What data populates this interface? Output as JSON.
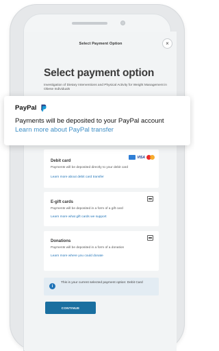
{
  "header": {
    "title": "Select Payment Option",
    "close_label": "×"
  },
  "main": {
    "title": "Select payment option",
    "subtitle": "Investigation of Dietary Interventions and Physical Activity for Weight Management in Obese Individuals"
  },
  "popup": {
    "name": "PayPal",
    "description": "Payments will be deposited to your PayPal account",
    "link": "Learn more about PayPal transfer"
  },
  "cards": [
    {
      "title": "Debit card",
      "description": "Payments will be deposited directly to your debit card",
      "link": "Learn more about debit card transfer",
      "icons": [
        "amex-icon",
        "visa-icon",
        "mastercard-icon"
      ],
      "visa_text": "VISA"
    },
    {
      "title": "E-gift cards",
      "description": "Payments will be deposited in a form of a gift card",
      "link": "Learn more what gift cards we support",
      "icons": [
        "gift-card-icon"
      ]
    },
    {
      "title": "Donations",
      "description": "Payments will be deposited in a form of a donation",
      "link": "Learn more where you could donate",
      "icons": [
        "donation-icon"
      ]
    }
  ],
  "info": {
    "icon_text": "i",
    "text": "This is your current selected payment option: Debit Card"
  },
  "continue_label": "CONTINUE",
  "colors": {
    "accent": "#1a6fa0",
    "link": "#1f73b7",
    "popup_link": "#3f8fc6",
    "background": "#f2f4f5"
  }
}
